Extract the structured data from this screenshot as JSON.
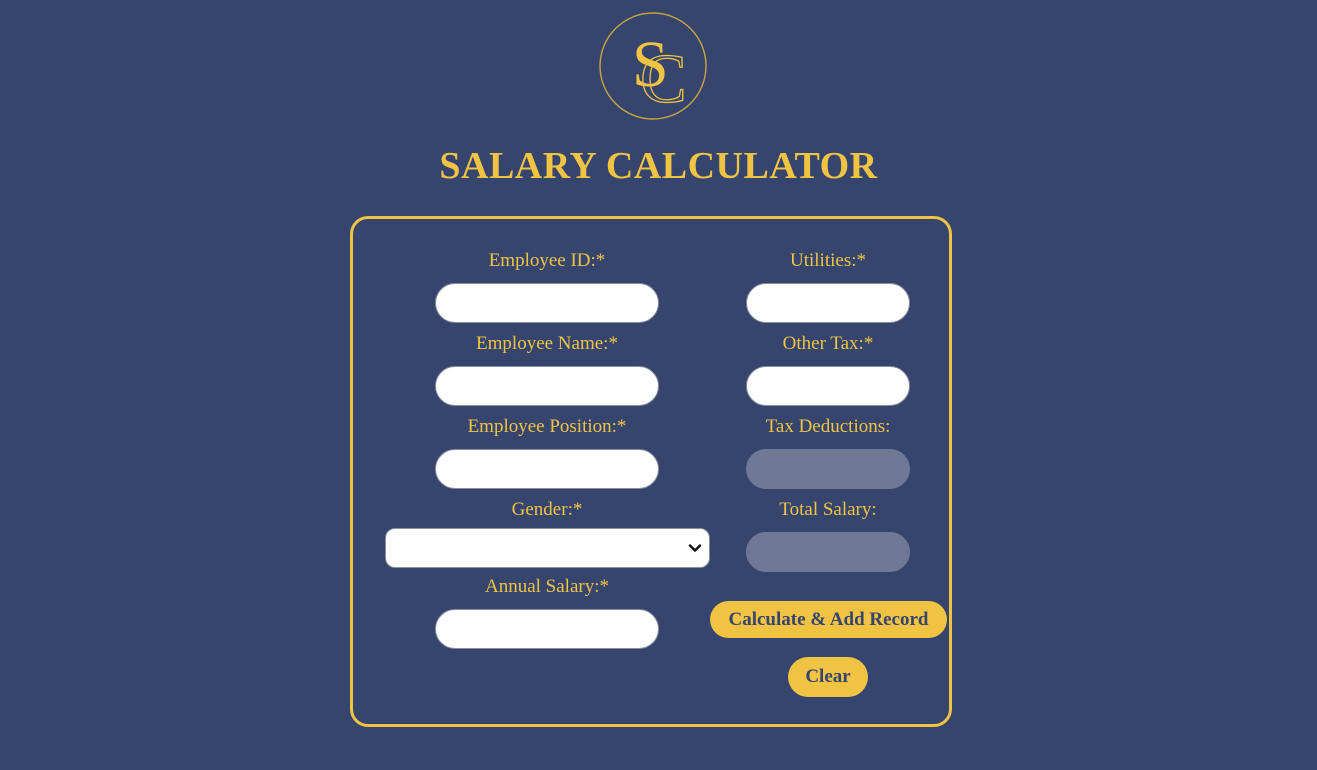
{
  "logo": {
    "monogram": "SC",
    "icon": "sc-monogram-logo"
  },
  "header": {
    "title": "SALARY CALCULATOR"
  },
  "form": {
    "left": {
      "employee_id_label": "Employee ID:*",
      "employee_name_label": "Employee Name:*",
      "employee_position_label": "Employee Position:*",
      "gender_label": "Gender:*",
      "gender_selected": "",
      "annual_salary_label": "Annual Salary:*"
    },
    "right": {
      "utilities_label": "Utilities:*",
      "other_tax_label": "Other Tax:*",
      "tax_deductions_label": "Tax Deductions:",
      "total_salary_label": "Total Salary:"
    },
    "buttons": {
      "calculate_label": "Calculate & Add Record",
      "clear_label": "Clear"
    }
  },
  "colors": {
    "background": "#36456e",
    "accent": "#f0c343",
    "readonly_field": "#6f7894"
  }
}
